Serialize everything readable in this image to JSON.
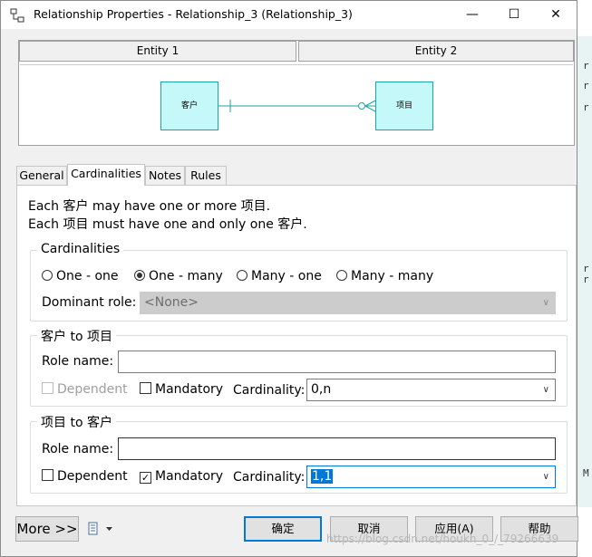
{
  "window": {
    "title": "Relationship Properties - Relationship_3 (Relationship_3)",
    "minimize": "—",
    "maximize": "☐",
    "close": "✕"
  },
  "diagram": {
    "entity1_header": "Entity 1",
    "entity2_header": "Entity 2",
    "entity1_name": "客户",
    "entity2_name": "项目"
  },
  "tabs": [
    {
      "label": "General",
      "active": false
    },
    {
      "label": "Cardinalities",
      "active": true
    },
    {
      "label": "Notes",
      "active": false
    },
    {
      "label": "Rules",
      "active": false
    }
  ],
  "description": {
    "line1": "Each 客户 may have one or more 项目.",
    "line2": "Each 项目 must have one and only one 客户."
  },
  "cardinalities": {
    "legend": "Cardinalities",
    "options": [
      {
        "label": "One - one",
        "selected": false
      },
      {
        "label": "One - many",
        "selected": true
      },
      {
        "label": "Many - one",
        "selected": false
      },
      {
        "label": "Many - many",
        "selected": false
      }
    ],
    "dominant_role_label": "Dominant role:",
    "dominant_role_value": "<None>"
  },
  "role1": {
    "legend": "客户 to 项目",
    "role_name_label": "Role name:",
    "role_name_value": "",
    "dependent_label": "Dependent",
    "dependent_checked": false,
    "dependent_enabled": false,
    "mandatory_label": "Mandatory",
    "mandatory_checked": false,
    "cardinality_label": "Cardinality:",
    "cardinality_value": "0,n"
  },
  "role2": {
    "legend": "项目 to 客户",
    "role_name_label": "Role name:",
    "role_name_value": "",
    "dependent_label": "Dependent",
    "dependent_checked": false,
    "dependent_enabled": true,
    "mandatory_label": "Mandatory",
    "mandatory_checked": true,
    "cardinality_label": "Cardinality:",
    "cardinality_value": "1,1"
  },
  "buttons": {
    "more": "More >>",
    "ok": "确定",
    "cancel": "取消",
    "apply": "应用(A)",
    "help": "帮助"
  },
  "watermark": "https://blog.csdn.net/houkh_0_/_79266639",
  "colors": {
    "entity_fill": "#c5f8f8",
    "entity_border": "#1aa5a5",
    "accent": "#0078d7"
  }
}
